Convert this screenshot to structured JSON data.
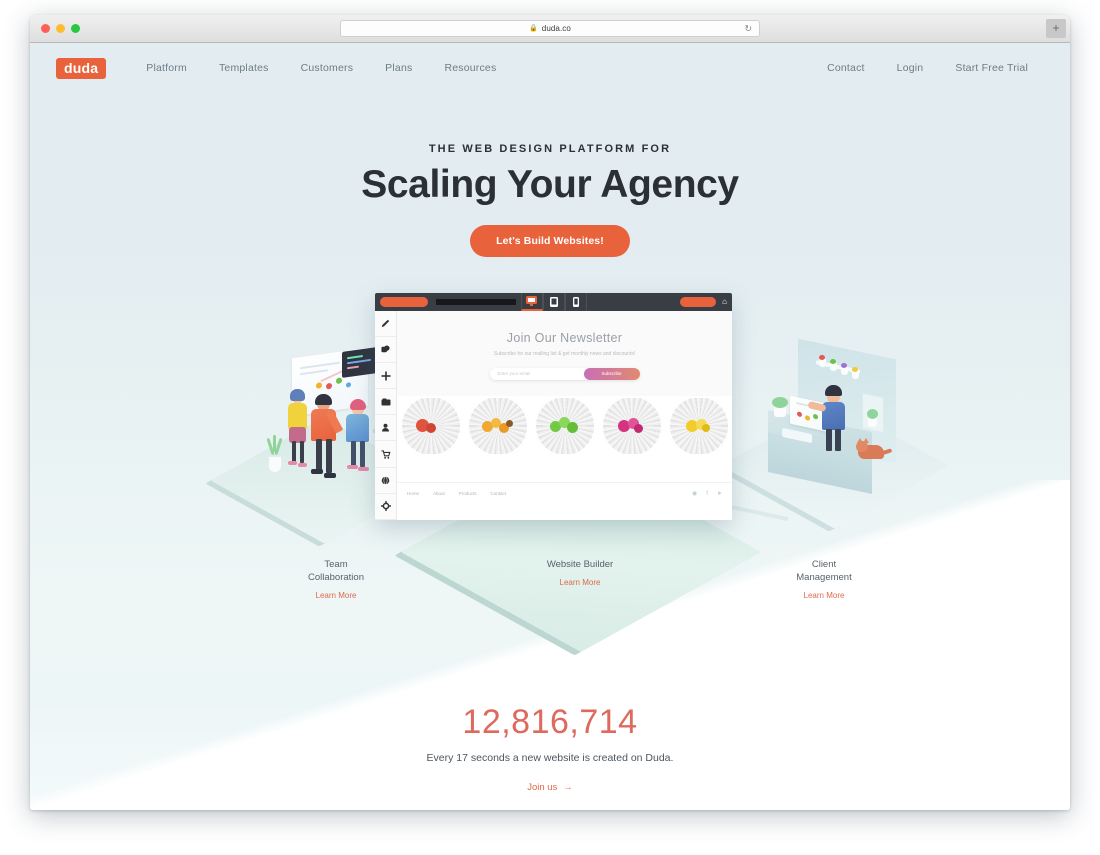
{
  "browser": {
    "url": "duda.co",
    "lock_icon": "lock-icon",
    "reload_icon": "reload-icon",
    "newtab_label": "+"
  },
  "nav": {
    "logo": "duda",
    "left_links": [
      "Platform",
      "Templates",
      "Customers",
      "Plans",
      "Resources"
    ],
    "right_links": [
      "Contact",
      "Login",
      "Start Free Trial"
    ]
  },
  "hero": {
    "eyebrow": "THE WEB DESIGN PLATFORM FOR",
    "headline": "Scaling Your Agency",
    "cta": "Let's Build Websites!",
    "cta_color": "#e8623c"
  },
  "builder": {
    "devices": [
      "desktop-icon",
      "tablet-icon",
      "mobile-icon"
    ],
    "active_device": "desktop-icon",
    "home_icon": "home-icon",
    "sidebar_icons": [
      "pencil-icon",
      "theme-palette-icon",
      "add-plus-icon",
      "photo-gallery-icon",
      "member-person-icon",
      "store-cart-icon",
      "blog-globe-icon",
      "settings-gear-icon"
    ],
    "newsletter": {
      "title": "Join Our Newsletter",
      "subtitle": "Subscribe for our mailing list & get monthly news and discounts!",
      "input_placeholder": "Enter your email",
      "button": "Subscribe"
    },
    "food_colors": [
      "#e0533f",
      "#f0a830",
      "#72c943",
      "#d4347e",
      "#f2cd2a"
    ],
    "footer_links": [
      "Home",
      "About",
      "Products",
      "Contact"
    ],
    "footer_socials": [
      "instagram-icon",
      "facebook-icon",
      "twitter-icon"
    ]
  },
  "features": [
    {
      "title": "Team\nCollaboration",
      "link": "Learn More"
    },
    {
      "title": "Website Builder",
      "link": "Learn More"
    },
    {
      "title": "Client\nManagement",
      "link": "Learn More"
    }
  ],
  "stats": {
    "count": "12,816,714",
    "subtitle": "Every 17 seconds a new website is created on Duda.",
    "link": "Join us",
    "arrow": "→",
    "accent_color": "#de6a5e"
  }
}
